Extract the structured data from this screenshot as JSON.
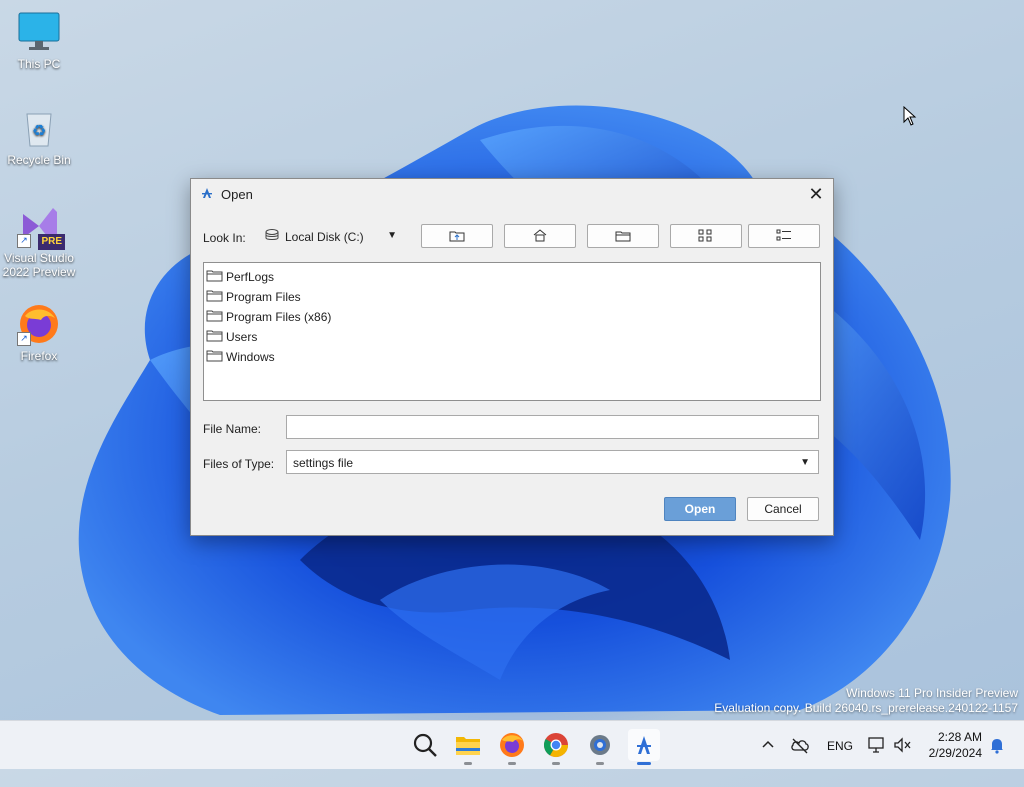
{
  "desktop": {
    "icons": [
      {
        "label": "This PC"
      },
      {
        "label": "Recycle Bin"
      },
      {
        "label": "Visual Studio 2022 Preview",
        "badge": "PRE"
      },
      {
        "label": "Firefox"
      }
    ],
    "shortcut_glyph": "↗"
  },
  "dialog": {
    "title": "Open",
    "close_glyph": "✕",
    "look_in_label": "Look In:",
    "look_in_value": "Local Disk (C:)",
    "files": [
      "PerfLogs",
      "Program Files",
      "Program Files (x86)",
      "Users",
      "Windows"
    ],
    "file_name_label": "File Name:",
    "file_name_value": "",
    "files_of_type_label": "Files of Type:",
    "files_of_type_value": "settings file",
    "open_label": "Open",
    "cancel_label": "Cancel",
    "toolbar_icons": [
      "up-folder-icon",
      "home-icon",
      "new-folder-icon",
      "list-view-icon",
      "details-view-icon"
    ]
  },
  "watermark": {
    "line1": "Windows 11 Pro Insider Preview",
    "line2": "Evaluation copy. Build 26040.rs_prerelease.240122-1157"
  },
  "taskbar": {
    "apps": [
      "search-icon",
      "file-explorer-icon",
      "firefox-icon",
      "chrome-icon",
      "settings-icon",
      "java-app-icon"
    ],
    "language": "ENG",
    "time": "2:28 AM",
    "date": "2/29/2024"
  },
  "colors": {
    "accent": "#2f6fd6",
    "open_button": "#6a9fd8"
  }
}
